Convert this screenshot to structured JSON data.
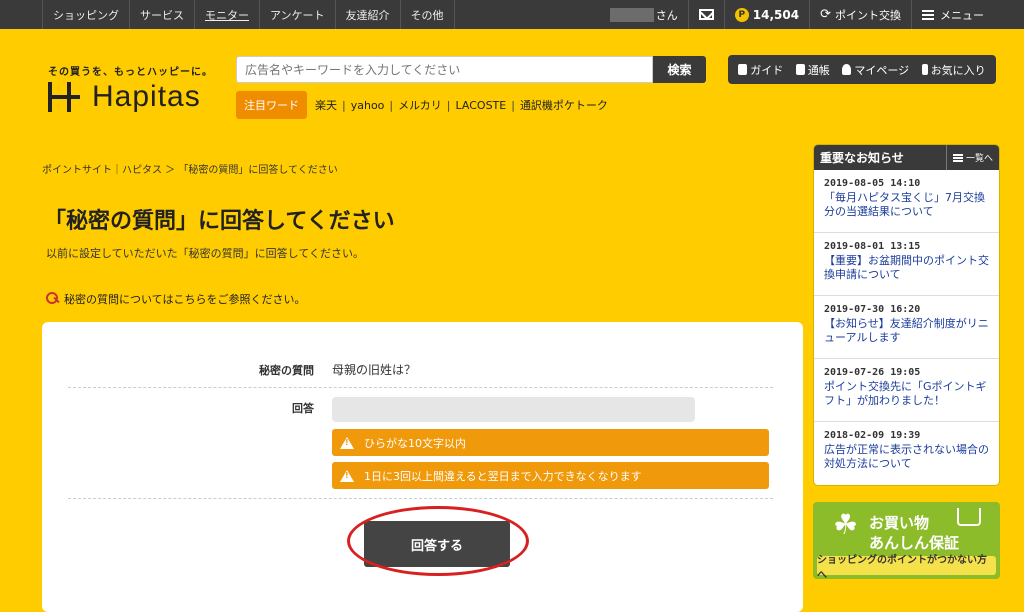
{
  "topnav": {
    "links": [
      "ショッピング",
      "サービス",
      "モニター",
      "アンケート",
      "友達紹介",
      "その他"
    ],
    "user_suffix": "さん",
    "points": "14,504",
    "point_badge": "P",
    "exchange": "ポイント交換",
    "menu": "メニュー"
  },
  "header": {
    "tagline": "その買うを、もっとハッピーに。",
    "logo": "Hapitas",
    "search_placeholder": "広告名やキーワードを入力してください",
    "search_button": "検索",
    "hot_label": "注目ワード",
    "hot_words": [
      "楽天",
      "yahoo",
      "メルカリ",
      "LACOSTE",
      "通訳機ポケトーク"
    ],
    "user_nav": [
      "ガイド",
      "通帳",
      "マイページ",
      "お気に入り"
    ]
  },
  "breadcrumb": "ポイントサイト｜ハピタス ＞ 「秘密の質問」に回答してください",
  "page": {
    "title": "「秘密の質問」に回答してください",
    "lead": "以前に設定していただいた「秘密の質問」に回答してください。",
    "help_link": "秘密の質問についてはこちらをご参照ください。"
  },
  "form": {
    "question_label": "秘密の質問",
    "question_value": "母親の旧姓は？",
    "answer_label": "回答",
    "warnings": [
      "ひらがな10文字以内",
      "1日に3回以上間違えると翌日まで入力できなくなります"
    ],
    "submit": "回答する"
  },
  "news": {
    "title": "重要なお知らせ",
    "all": "一覧へ",
    "items": [
      {
        "date": "2019-08-05 14:10",
        "title": "「毎月ハピタス宝くじ」7月交換分の当選結果について"
      },
      {
        "date": "2019-08-01 13:15",
        "title": "【重要】お盆期間中のポイント交換申請について"
      },
      {
        "date": "2019-07-30 16:20",
        "title": "【お知らせ】友達紹介制度がリニューアルします"
      },
      {
        "date": "2019-07-26 19:05",
        "title": "ポイント交換先に「Gポイントギフト」が加わりました！"
      },
      {
        "date": "2018-02-09 19:39",
        "title": "広告が正常に表示されない場合の対処方法について"
      }
    ]
  },
  "banner": {
    "line1": "お買い物",
    "line2": "あんしん保証",
    "sub": "ショッピングのポイントがつかない方へ"
  }
}
